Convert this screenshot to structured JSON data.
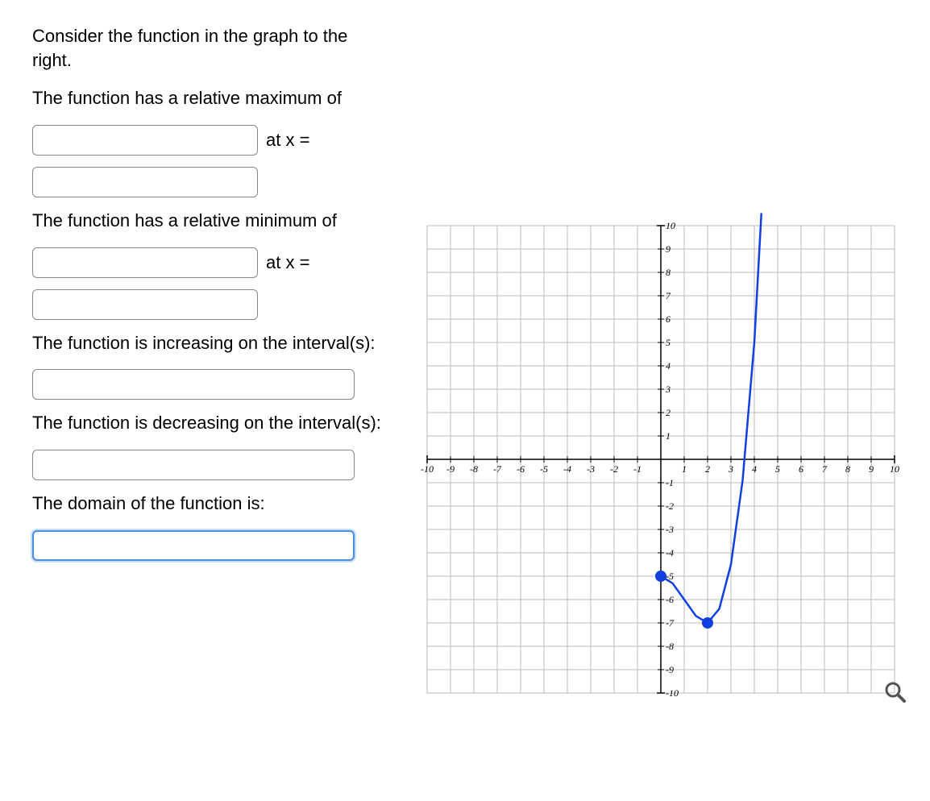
{
  "prompt1": "Consider the function in the graph to the right.",
  "prompt2": "The function has a relative maximum of",
  "atx": "at x =",
  "prompt3": "The function has a relative minimum of",
  "prompt4": "The function is increasing on the interval(s):",
  "prompt5": "The function is decreasing on the interval(s):",
  "prompt6": "The domain of the function is:",
  "chart_data": {
    "type": "line",
    "xlim": [
      -10,
      10
    ],
    "ylim": [
      -10,
      10
    ],
    "xticks": [
      -10,
      -9,
      -8,
      -7,
      -6,
      -5,
      -4,
      -3,
      -2,
      -1,
      1,
      2,
      3,
      4,
      5,
      6,
      7,
      8,
      9,
      10
    ],
    "yticks": [
      -10,
      -9,
      -8,
      -7,
      -6,
      -5,
      -4,
      -3,
      -2,
      -1,
      1,
      2,
      3,
      4,
      5,
      6,
      7,
      8,
      9,
      10
    ],
    "points_marked": [
      {
        "x": 0,
        "y": -5,
        "label": "relative maximum"
      },
      {
        "x": 2,
        "y": -7,
        "label": "relative minimum"
      }
    ],
    "curve_samples": [
      {
        "x": 0.0,
        "y": -5.0
      },
      {
        "x": 0.5,
        "y": -5.3
      },
      {
        "x": 1.0,
        "y": -6.0
      },
      {
        "x": 1.5,
        "y": -6.7
      },
      {
        "x": 2.0,
        "y": -7.0
      },
      {
        "x": 2.5,
        "y": -6.4
      },
      {
        "x": 3.0,
        "y": -4.5
      },
      {
        "x": 3.5,
        "y": -0.9
      },
      {
        "x": 4.0,
        "y": 5.0
      },
      {
        "x": 4.3,
        "y": 10.5
      }
    ],
    "domain_start_closed": true
  }
}
